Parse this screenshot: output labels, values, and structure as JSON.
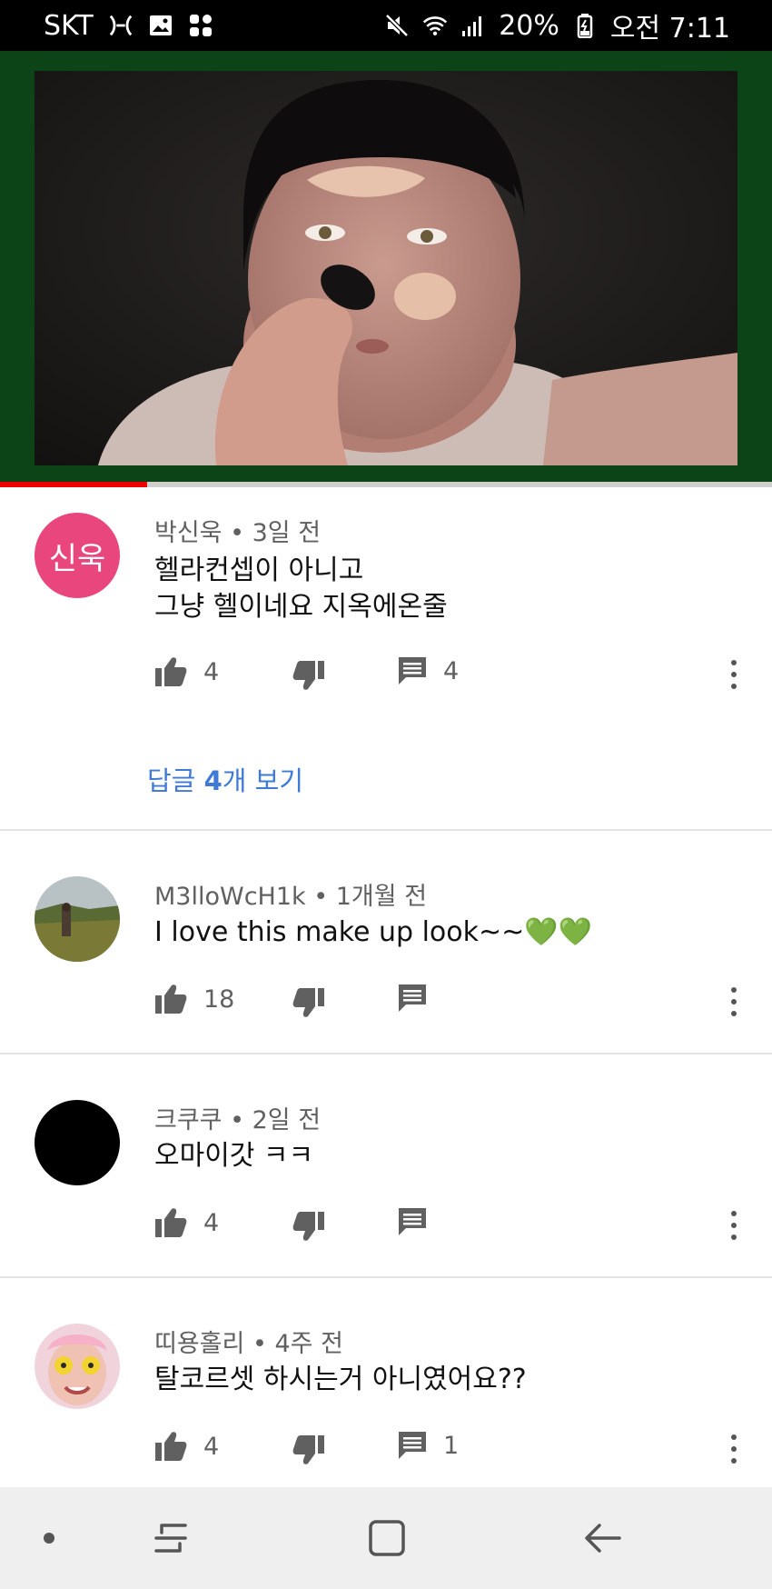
{
  "status_bar": {
    "carrier": "SKT",
    "battery": "20%",
    "time": "오전 7:11"
  },
  "video": {
    "progress_fraction": 0.19
  },
  "comments": [
    {
      "author": "박신욱",
      "time": "3일 전",
      "avatar_text": "신욱",
      "avatar_color": "#e8467c",
      "lines": [
        "헬라컨셉이 아니고",
        "그냥 헬이네요 지옥에온줄"
      ],
      "likes": "4",
      "replies": "4",
      "view_replies": {
        "prefix": "답글 ",
        "count": "4",
        "suffix": "개 보기"
      }
    },
    {
      "author": "M3lloWcH1k",
      "time": "1개월 전",
      "lines": [
        "I love this make up look~~💚💚"
      ],
      "likes": "18",
      "replies": ""
    },
    {
      "author": "크쿠쿠",
      "time": "2일 전",
      "lines": [
        "오마이갓 ㅋㅋ"
      ],
      "likes": "4",
      "replies": ""
    },
    {
      "author": "띠용홀리",
      "time": "4주 전",
      "lines": [
        "탈코르셋 하시는거 아니였어요??"
      ],
      "likes": "4",
      "replies": "1"
    }
  ],
  "meta_separator": " • ",
  "icons": {
    "like": "thumb-up-icon",
    "dislike": "thumb-down-icon",
    "reply": "comment-icon",
    "more": "more-vertical-icon"
  }
}
